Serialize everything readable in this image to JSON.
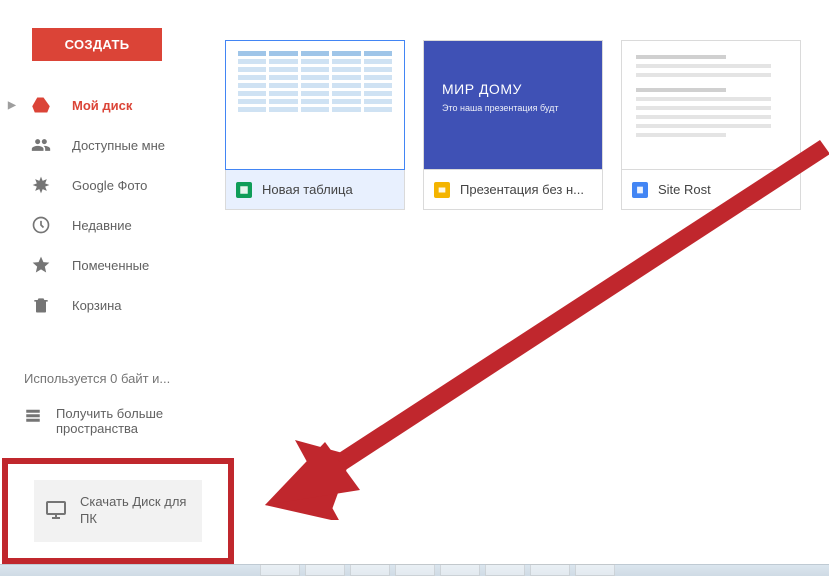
{
  "create_label": "СОЗДАТЬ",
  "nav": [
    {
      "label": "Мой диск",
      "icon": "drive"
    },
    {
      "label": "Доступные мне",
      "icon": "shared"
    },
    {
      "label": "Google Фото",
      "icon": "photos"
    },
    {
      "label": "Недавние",
      "icon": "recent"
    },
    {
      "label": "Помеченные",
      "icon": "starred"
    },
    {
      "label": "Корзина",
      "icon": "trash"
    }
  ],
  "storage_text": "Используется 0 байт и...",
  "get_more": "Получить больше пространства",
  "download_label": "Скачать Диск для ПК",
  "files": [
    {
      "label": "Новая таблица",
      "type": "sheets"
    },
    {
      "label": "Презентация без н...",
      "type": "slides",
      "slide_title": "МИР ДОМУ",
      "slide_sub": "Это наша презентация будт"
    },
    {
      "label": "Site Rost",
      "type": "docs"
    }
  ]
}
